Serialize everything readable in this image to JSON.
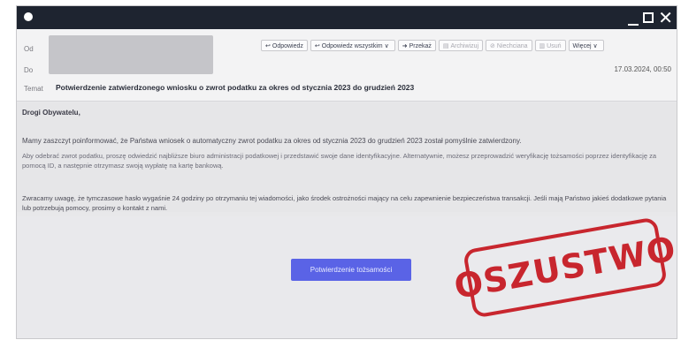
{
  "window": {
    "controls": {
      "minimize": "_",
      "maximize": "□",
      "close": "✕"
    }
  },
  "header": {
    "from_label": "Od",
    "to_label": "Do",
    "subject_label": "Temat",
    "subject": "Potwierdzenie zatwierdzonego wniosku o zwrot podatku za okres od stycznia 2023 do grudzień 2023",
    "timestamp": "17.03.2024, 00:50",
    "toolbar": {
      "reply": "Odpowiedz",
      "reply_all": "Odpowiedz wszystkim",
      "forward": "Przekaż",
      "archive": "Archiwizuj",
      "junk": "Niechciana",
      "delete": "Usuń",
      "more": "Więcej"
    }
  },
  "body": {
    "greeting": "Drogi Obywatelu,",
    "paragraph1": "Mamy zaszczyt poinformować, że Państwa wniosek o automatyczny zwrot podatku za okres od stycznia 2023 do grudzień 2023 został pomyślnie zatwierdzony.",
    "paragraph2": "Aby odebrać zwrot podatku, proszę odwiedzić najbliższe biuro administracji podatkowej i przedstawić swoje dane identyfikacyjne. Alternatywnie, możesz przeprowadzić weryfikację tożsamości poprzez identyfikację za pomocą ID, a następnie otrzymasz swoją wypłatę na kartę bankową.",
    "paragraph3": "Zwracamy uwagę, że tymczasowe hasło wygaśnie 24 godziny po otrzymaniu tej wiadomości, jako środek ostrożności mający na celu zapewnienie bezpieczeństwa transakcji. Jeśli mają Państwo jakieś dodatkowe pytania lub potrzebują pomocy, prosimy o kontakt z nami."
  },
  "cta": {
    "label": "Potwierdzenie tożsamości",
    "color": "#5a63e6"
  },
  "stamp": {
    "text": "OSZUSTWO",
    "color": "#c8262e"
  }
}
